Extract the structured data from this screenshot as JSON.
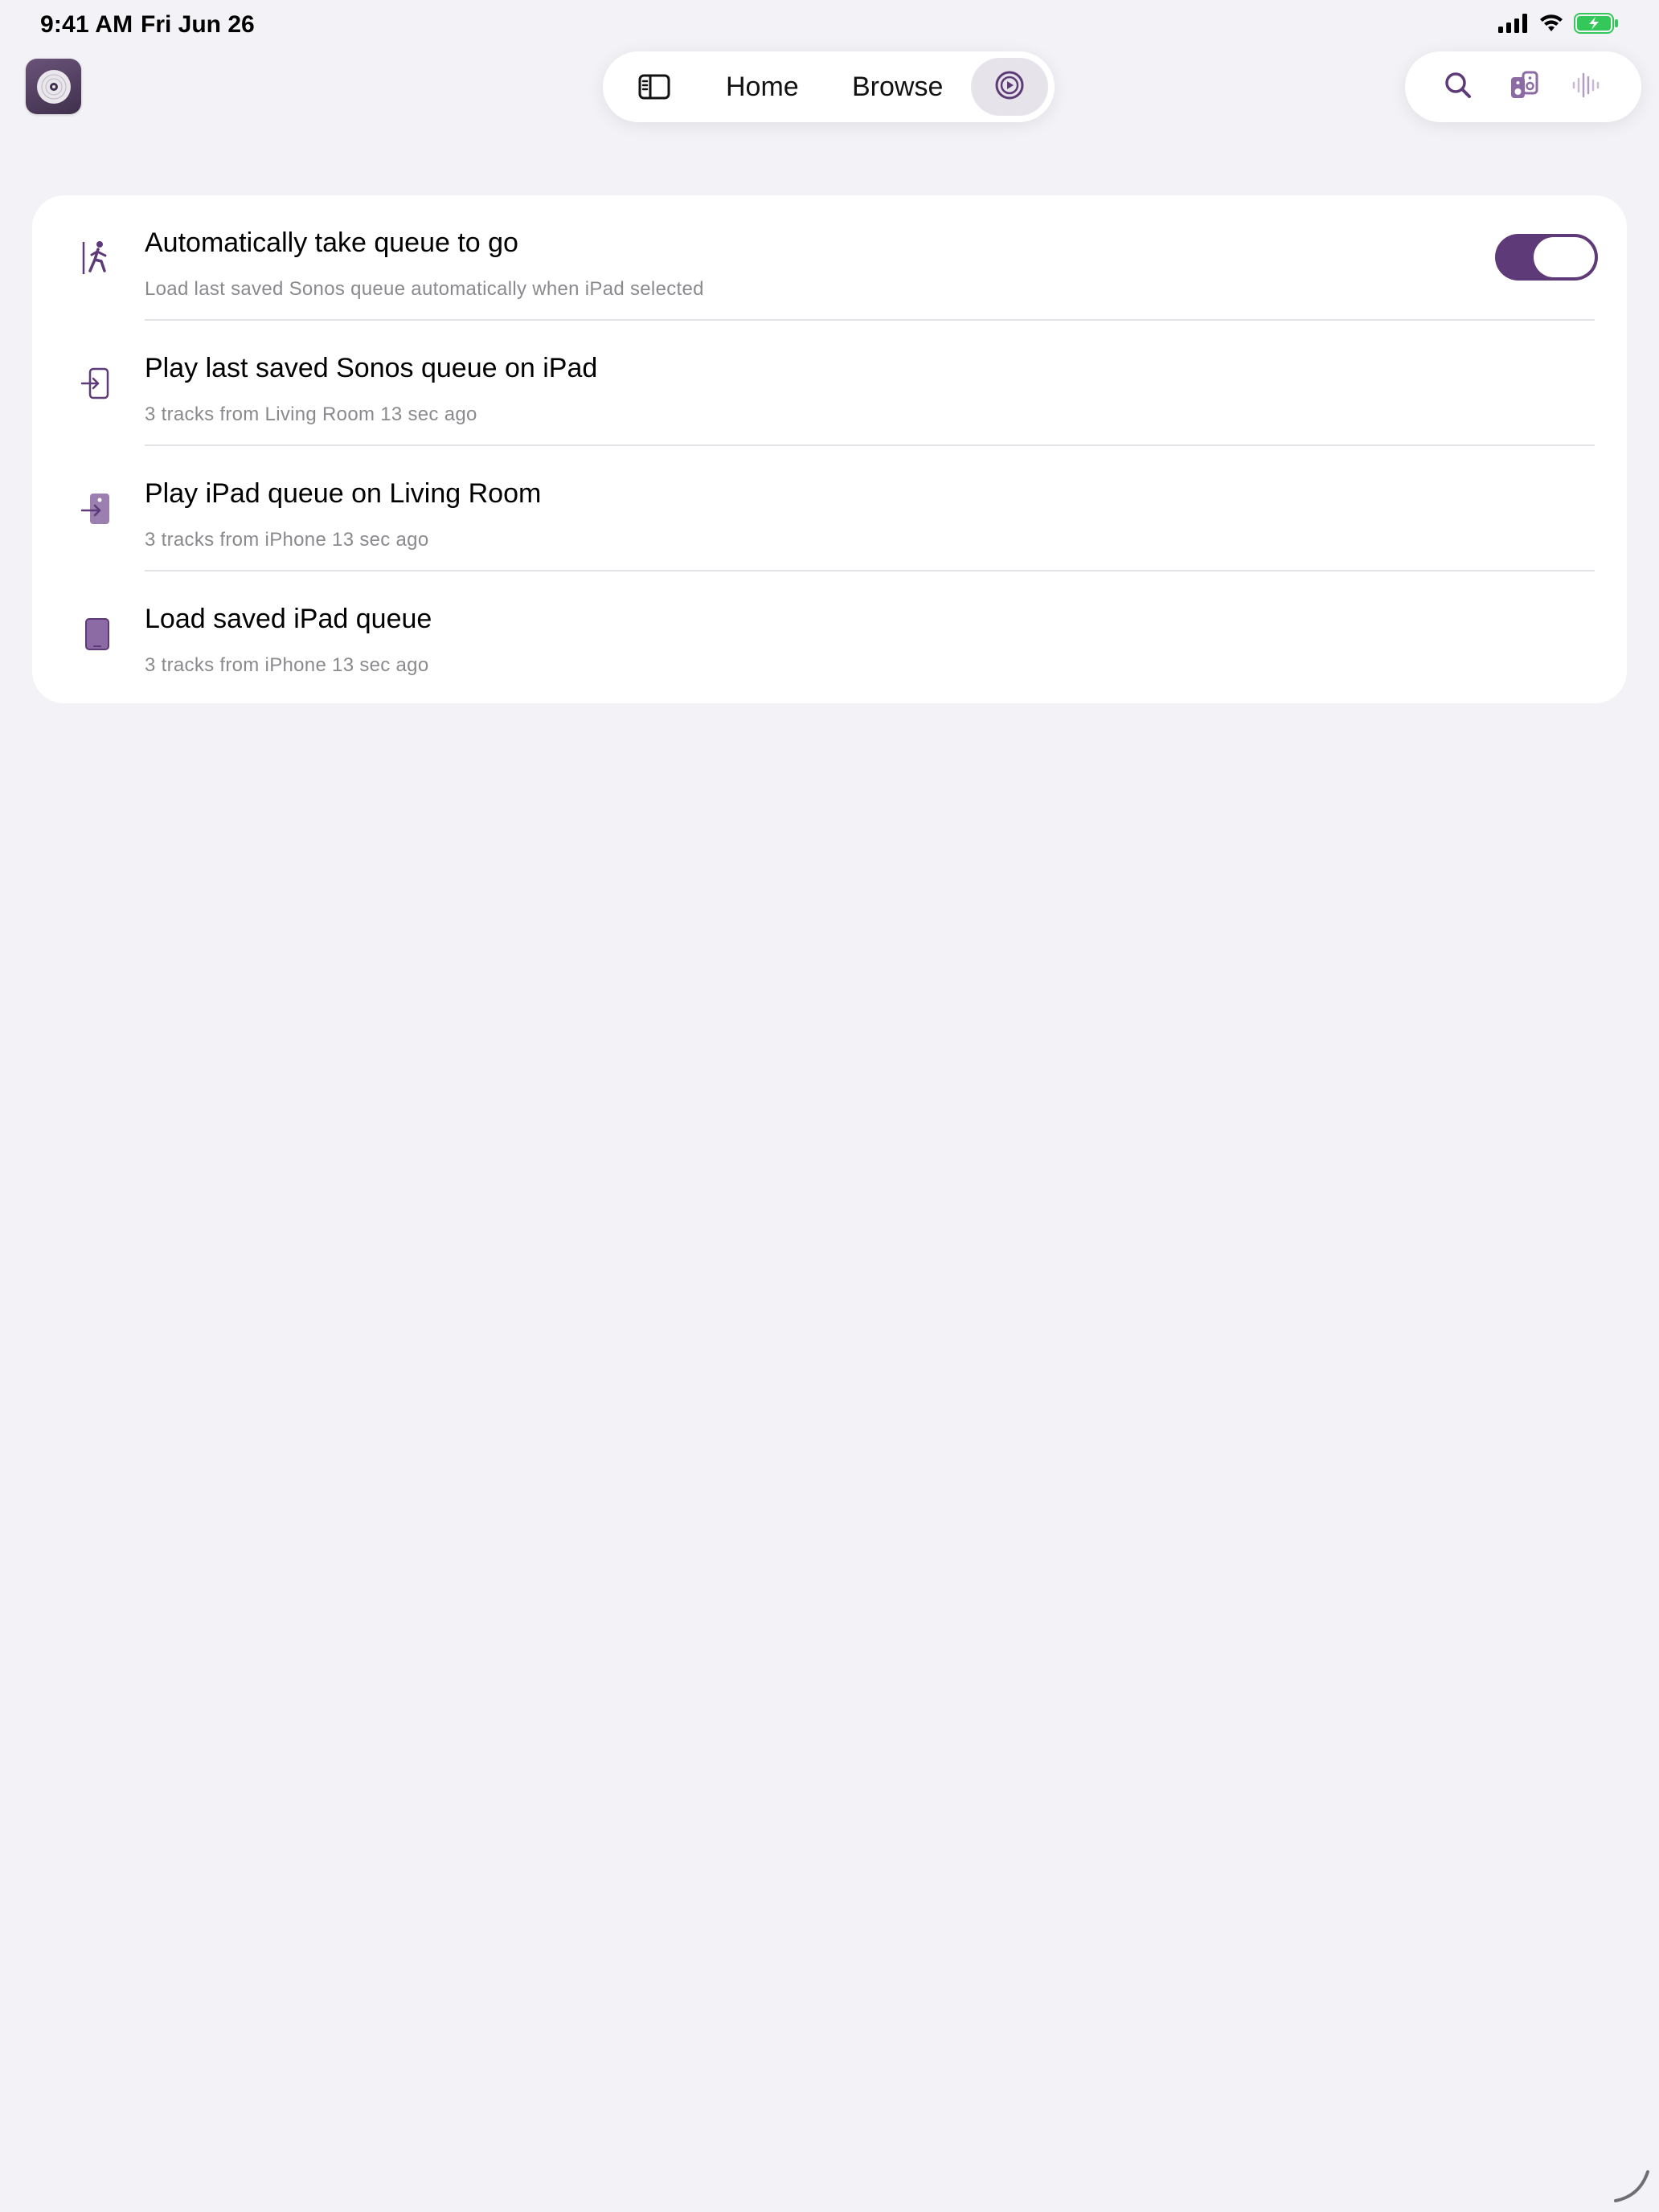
{
  "status_bar": {
    "time": "9:41 AM",
    "date": "Fri Jun 26",
    "icons": [
      "cellular-signal-icon",
      "wifi-icon",
      "battery-charging-icon"
    ]
  },
  "app": {
    "icon": "sonos-app-icon"
  },
  "nav": {
    "sidebar_icon": "sidebar-toggle-icon",
    "tabs": [
      {
        "label": "Home"
      },
      {
        "label": "Browse"
      }
    ],
    "active_icon": "now-playing-queue-icon"
  },
  "actions": {
    "icons": [
      "search-icon",
      "speakers-icon",
      "voice-waveform-icon"
    ]
  },
  "queue_settings": {
    "rows": [
      {
        "icon": "walk-out-icon",
        "title": "Automatically take queue to go",
        "subtitle": "Load last saved Sonos queue automatically when iPad selected",
        "toggle_on": true
      },
      {
        "icon": "arrow-into-ipad-icon",
        "title": "Play last saved Sonos queue on iPad",
        "subtitle": "3 tracks from Living Room 13 sec ago"
      },
      {
        "icon": "arrow-into-speaker-icon",
        "title": "Play iPad queue on Living Room",
        "subtitle": "3 tracks from iPhone 13 sec ago"
      },
      {
        "icon": "ipad-icon",
        "title": "Load saved iPad queue",
        "subtitle": "3 tracks from iPhone 13 sec ago"
      }
    ]
  },
  "colors": {
    "accent": "#5e3a78",
    "background": "#f2f2f7",
    "card": "#ffffff",
    "secondary_text": "#8a8a8e"
  }
}
